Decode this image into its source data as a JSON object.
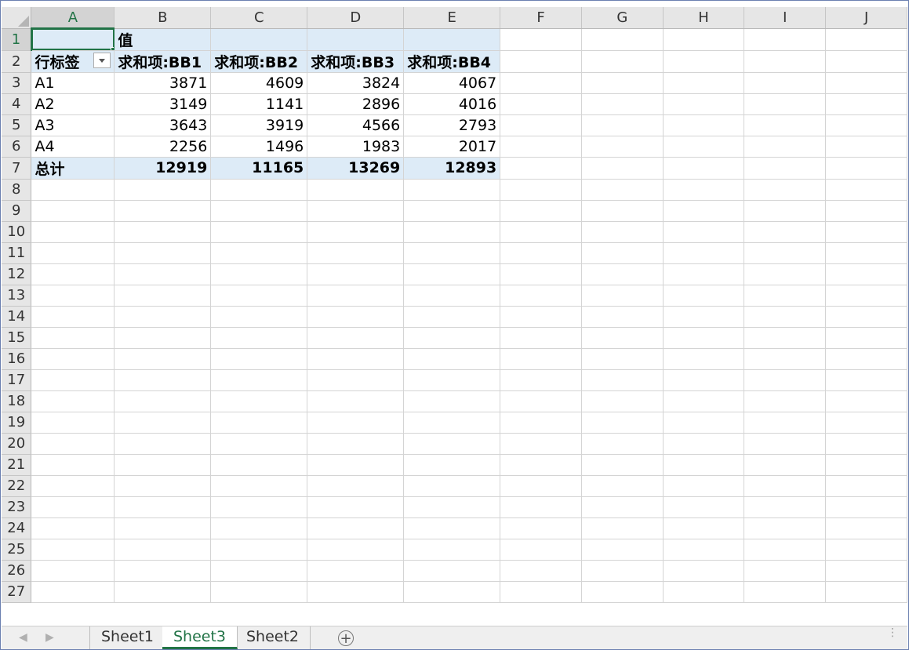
{
  "columns": [
    "A",
    "B",
    "C",
    "D",
    "E",
    "F",
    "G",
    "H",
    "I",
    "J"
  ],
  "rows": [
    "1",
    "2",
    "3",
    "4",
    "5",
    "6",
    "7",
    "8",
    "9",
    "10",
    "11",
    "12",
    "13",
    "14",
    "15",
    "16",
    "17",
    "18",
    "19",
    "20",
    "21",
    "22",
    "23",
    "24",
    "25",
    "26",
    "27"
  ],
  "pivot": {
    "values_label": "值",
    "row_label_header": "行标签",
    "headers": [
      "求和项:BB1",
      "求和项:BB2",
      "求和项:BB3",
      "求和项:BB4"
    ],
    "data_rows": [
      {
        "label": "A1",
        "values": [
          "3871",
          "4609",
          "3824",
          "4067"
        ]
      },
      {
        "label": "A2",
        "values": [
          "3149",
          "1141",
          "2896",
          "4016"
        ]
      },
      {
        "label": "A3",
        "values": [
          "3643",
          "3919",
          "4566",
          "2793"
        ]
      },
      {
        "label": "A4",
        "values": [
          "2256",
          "1496",
          "1983",
          "2017"
        ]
      }
    ],
    "total": {
      "label": "总计",
      "values": [
        "12919",
        "11165",
        "13269",
        "12893"
      ]
    }
  },
  "tabs": {
    "nav_prev": "◀",
    "nav_next": "▶",
    "items": [
      "Sheet1",
      "Sheet3",
      "Sheet2"
    ],
    "active": "Sheet3",
    "add_symbol": "+",
    "grip": "⋮"
  },
  "colors": {
    "accent": "#217346",
    "pivot_fill": "#ddebf7"
  }
}
